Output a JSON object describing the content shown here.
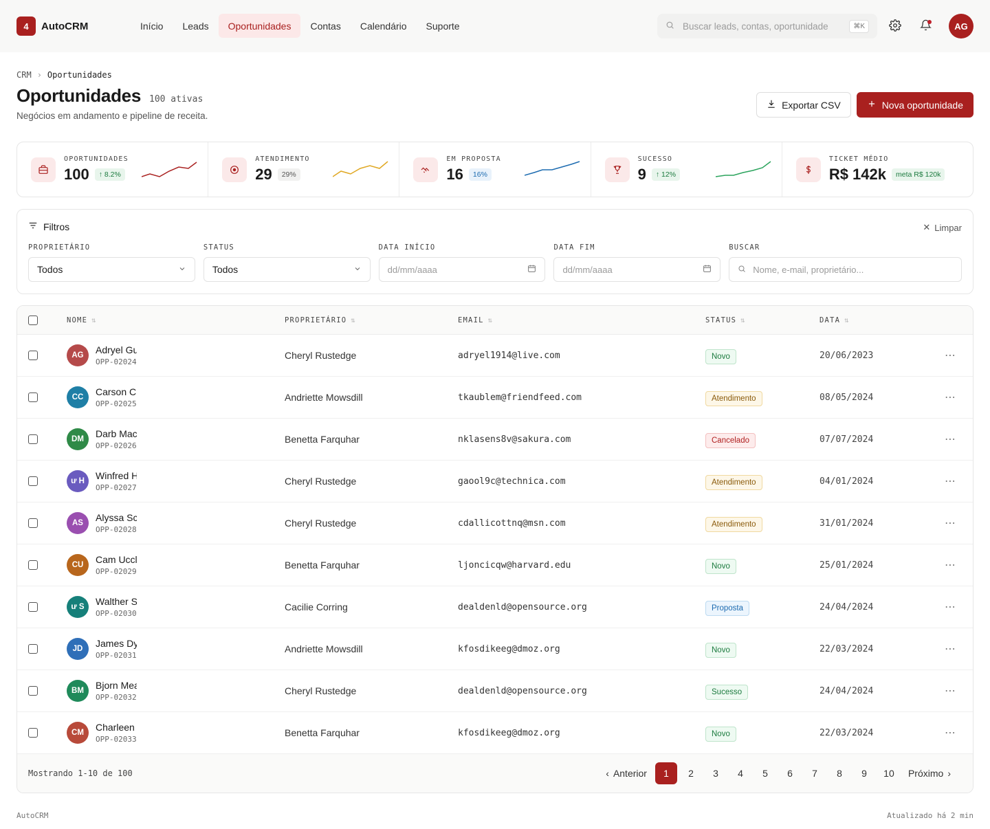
{
  "brand": {
    "badge": "4",
    "name": "AutoCRM"
  },
  "nav": [
    {
      "label": "Início",
      "active": false
    },
    {
      "label": "Leads",
      "active": false
    },
    {
      "label": "Oportunidades",
      "active": true
    },
    {
      "label": "Contas",
      "active": false
    },
    {
      "label": "Calendário",
      "active": false
    },
    {
      "label": "Suporte",
      "active": false
    }
  ],
  "search": {
    "placeholder": "Buscar leads, contas, oportunidade",
    "shortcut": "⌘K"
  },
  "user": {
    "initials": "AG"
  },
  "breadcrumb": {
    "root": "CRM",
    "current": "Oportunidades"
  },
  "page": {
    "title": "Oportunidades",
    "count": "100 ativas",
    "subtitle": "Negócios em andamento e pipeline de receita.",
    "export_label": "Exportar CSV",
    "new_label": "Nova oportunidade"
  },
  "stats": [
    {
      "label": "OPORTUNIDADES",
      "value": "100",
      "badge": "8.2%",
      "badge_arrow": "↑",
      "badge_style": "green",
      "icon": "briefcase-icon",
      "spark_color": "#a9201f"
    },
    {
      "label": "ATENDIMENTO",
      "value": "29",
      "badge": "29%",
      "badge_arrow": "",
      "badge_style": "gray",
      "icon": "target-icon",
      "spark_color": "#e0a823"
    },
    {
      "label": "EM PROPOSTA",
      "value": "16",
      "badge": "16%",
      "badge_arrow": "",
      "badge_style": "blue",
      "icon": "handshake-icon",
      "spark_color": "#1c6bb0"
    },
    {
      "label": "SUCESSO",
      "value": "9",
      "badge": "12%",
      "badge_arrow": "↑",
      "badge_style": "green",
      "icon": "trophy-icon",
      "spark_color": "#2aa35c"
    },
    {
      "label": "TICKET MÉDIO",
      "value": "R$ 142k",
      "badge": "meta R$ 120k",
      "badge_arrow": "",
      "badge_style": "green",
      "icon": "dollar-icon",
      "spark_color": ""
    }
  ],
  "filters": {
    "title": "Filtros",
    "clear_label": "Limpar",
    "owner_label": "PROPRIETÁRIO",
    "owner_value": "Todos",
    "status_label": "STATUS",
    "status_value": "Todos",
    "start_label": "DATA INÍCIO",
    "start_placeholder": "dd/mm/aaaa",
    "end_label": "DATA FIM",
    "end_placeholder": "dd/mm/aaaa",
    "search_label": "BUSCAR",
    "search_placeholder": "Nome, e-mail, proprietário..."
  },
  "table": {
    "headers": {
      "name": "NOME",
      "owner": "PROPRIETÁRIO",
      "email": "EMAIL",
      "status": "STATUS",
      "date": "DATA"
    },
    "rows": [
      {
        "initials": "AG",
        "avatar_color": "#b54a4a",
        "name": "Adryel Gu",
        "id": "OPP-02024",
        "owner": "Cheryl Rustedge",
        "email": "adryel1914@live.com",
        "status": "Novo",
        "status_style": "novo",
        "date": "20/06/2023"
      },
      {
        "initials": "CC",
        "avatar_color": "#1f7fa6",
        "name": "Carson Cr",
        "id": "OPP-02025",
        "owner": "Andriette Mowsdill",
        "email": "tkaublem@friendfeed.com",
        "status": "Atendimento",
        "status_style": "atend",
        "date": "08/05/2024"
      },
      {
        "initials": "DM",
        "avatar_color": "#2f8a47",
        "name": "Darb Mac",
        "id": "OPP-02026",
        "owner": "Benetta Farquhar",
        "email": "nklasens8v@sakura.com",
        "status": "Cancelado",
        "status_style": "canc",
        "date": "07/07/2024"
      },
      {
        "initials": "ư H",
        "avatar_color": "#6a5bbf",
        "name": "Winfred H",
        "id": "OPP-02027",
        "owner": "Cheryl Rustedge",
        "email": "gaool9c@technica.com",
        "status": "Atendimento",
        "status_style": "atend",
        "date": "04/01/2024"
      },
      {
        "initials": "AS",
        "avatar_color": "#9a4fb0",
        "name": "Alyssa Sc",
        "id": "OPP-02028",
        "owner": "Cheryl Rustedge",
        "email": "cdallicottnq@msn.com",
        "status": "Atendimento",
        "status_style": "atend",
        "date": "31/01/2024"
      },
      {
        "initials": "CU",
        "avatar_color": "#b8661c",
        "name": "Cam Uccl",
        "id": "OPP-02029",
        "owner": "Benetta Farquhar",
        "email": "ljoncicqw@harvard.edu",
        "status": "Novo",
        "status_style": "novo",
        "date": "25/01/2024"
      },
      {
        "initials": "ư S",
        "avatar_color": "#16807a",
        "name": "Walther S",
        "id": "OPP-02030",
        "owner": "Cacilie Corring",
        "email": "dealdenld@opensource.org",
        "status": "Proposta",
        "status_style": "prop",
        "date": "24/04/2024"
      },
      {
        "initials": "JD",
        "avatar_color": "#2f6fb8",
        "name": "James Dy",
        "id": "OPP-02031",
        "owner": "Andriette Mowsdill",
        "email": "kfosdikeeg@dmoz.org",
        "status": "Novo",
        "status_style": "novo",
        "date": "22/03/2024"
      },
      {
        "initials": "BM",
        "avatar_color": "#1f8a5a",
        "name": "Bjorn Mea",
        "id": "OPP-02032",
        "owner": "Cheryl Rustedge",
        "email": "dealdenld@opensource.org",
        "status": "Sucesso",
        "status_style": "suc",
        "date": "24/04/2024"
      },
      {
        "initials": "CM",
        "avatar_color": "#b84a3a",
        "name": "Charleen",
        "id": "OPP-02033",
        "owner": "Benetta Farquhar",
        "email": "kfosdikeeg@dmoz.org",
        "status": "Novo",
        "status_style": "novo",
        "date": "22/03/2024"
      }
    ]
  },
  "pagination": {
    "summary": "Mostrando 1-10 de 100",
    "prev_label": "Anterior",
    "next_label": "Próximo",
    "pages": [
      "1",
      "2",
      "3",
      "4",
      "5",
      "6",
      "7",
      "8",
      "9",
      "10"
    ],
    "current": "1"
  },
  "footer": {
    "left": "AutoCRM",
    "right": "Atualizado há 2 min"
  }
}
